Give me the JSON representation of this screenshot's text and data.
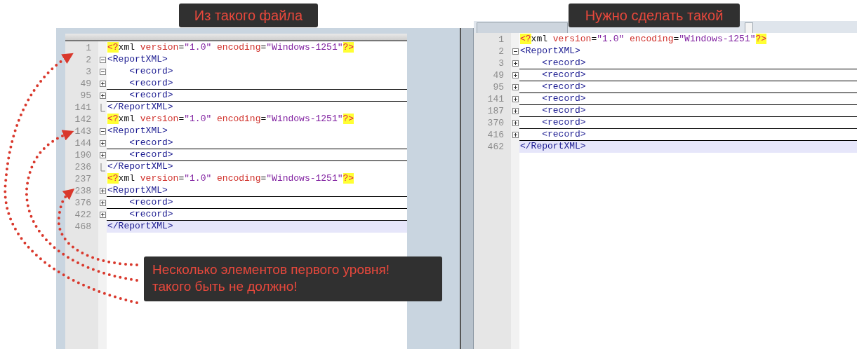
{
  "captions": [
    {
      "text": "Из такого файла"
    },
    {
      "text": "Нужно сделать такой"
    }
  ],
  "editors": [
    {
      "lines": [
        {
          "number": "1",
          "kind": "plain",
          "underline": false,
          "current": false,
          "tokens": [
            {
              "kind": "pi",
              "text": "<?"
            },
            {
              "kind": "name",
              "text": "xml"
            },
            {
              "kind": "attr",
              "text": " version"
            },
            {
              "kind": "eq",
              "text": "="
            },
            {
              "kind": "value",
              "text": "\"1.0\""
            },
            {
              "kind": "attr",
              "text": " encoding"
            },
            {
              "kind": "eq",
              "text": "="
            },
            {
              "kind": "value",
              "text": "\"Windows-1251\""
            },
            {
              "kind": "pi",
              "text": "?>"
            }
          ]
        },
        {
          "number": "2",
          "kind": "collapse",
          "underline": false,
          "current": false,
          "tokens": [
            {
              "kind": "tag",
              "text": "<ReportXML>"
            }
          ]
        },
        {
          "number": "3",
          "kind": "collapse",
          "underline": false,
          "current": false,
          "tokens": [
            {
              "kind": "tag",
              "text": "    <record>"
            }
          ]
        },
        {
          "number": "49",
          "kind": "expand",
          "underline": true,
          "current": false,
          "tokens": [
            {
              "kind": "tag",
              "text": "    <record>"
            }
          ]
        },
        {
          "number": "95",
          "kind": "expand",
          "underline": true,
          "current": false,
          "tokens": [
            {
              "kind": "tag",
              "text": "    <record>"
            }
          ]
        },
        {
          "number": "141",
          "kind": "block-end",
          "underline": false,
          "current": false,
          "tokens": [
            {
              "kind": "tag",
              "text": "</ReportXML>"
            }
          ]
        },
        {
          "number": "142",
          "kind": "plain",
          "underline": false,
          "current": false,
          "tokens": [
            {
              "kind": "pi",
              "text": "<?"
            },
            {
              "kind": "name",
              "text": "xml"
            },
            {
              "kind": "attr",
              "text": " version"
            },
            {
              "kind": "eq",
              "text": "="
            },
            {
              "kind": "value",
              "text": "\"1.0\""
            },
            {
              "kind": "attr",
              "text": " encoding"
            },
            {
              "kind": "eq",
              "text": "="
            },
            {
              "kind": "value",
              "text": "\"Windows-1251\""
            },
            {
              "kind": "pi",
              "text": "?>"
            }
          ]
        },
        {
          "number": "143",
          "kind": "collapse",
          "underline": false,
          "current": false,
          "tokens": [
            {
              "kind": "tag",
              "text": "<ReportXML>"
            }
          ]
        },
        {
          "number": "144",
          "kind": "expand",
          "underline": true,
          "current": false,
          "tokens": [
            {
              "kind": "tag",
              "text": "    <record>"
            }
          ]
        },
        {
          "number": "190",
          "kind": "expand",
          "underline": true,
          "current": false,
          "tokens": [
            {
              "kind": "tag",
              "text": "    <record>"
            }
          ]
        },
        {
          "number": "236",
          "kind": "block-end",
          "underline": false,
          "current": false,
          "tokens": [
            {
              "kind": "tag",
              "text": "</ReportXML>"
            }
          ]
        },
        {
          "number": "237",
          "kind": "plain",
          "underline": false,
          "current": false,
          "tokens": [
            {
              "kind": "pi",
              "text": "<?"
            },
            {
              "kind": "name",
              "text": "xml"
            },
            {
              "kind": "attr",
              "text": " version"
            },
            {
              "kind": "eq",
              "text": "="
            },
            {
              "kind": "value",
              "text": "\"1.0\""
            },
            {
              "kind": "attr",
              "text": " encoding"
            },
            {
              "kind": "eq",
              "text": "="
            },
            {
              "kind": "value",
              "text": "\"Windows-1251\""
            },
            {
              "kind": "pi",
              "text": "?>"
            }
          ]
        },
        {
          "number": "238",
          "kind": "expand",
          "underline": true,
          "current": false,
          "tokens": [
            {
              "kind": "tag",
              "text": "<ReportXML>"
            }
          ]
        },
        {
          "number": "376",
          "kind": "expand",
          "underline": true,
          "current": false,
          "tokens": [
            {
              "kind": "tag",
              "text": "    <record>"
            }
          ]
        },
        {
          "number": "422",
          "kind": "expand",
          "underline": true,
          "current": false,
          "tokens": [
            {
              "kind": "tag",
              "text": "    <record>"
            }
          ]
        },
        {
          "number": "468",
          "kind": "plain",
          "underline": false,
          "current": true,
          "tokens": [
            {
              "kind": "tag",
              "text": "</ReportXML>"
            }
          ]
        }
      ]
    },
    {
      "lines": [
        {
          "number": "1",
          "kind": "plain",
          "underline": false,
          "current": false,
          "tokens": [
            {
              "kind": "pi",
              "text": "<?"
            },
            {
              "kind": "name",
              "text": "xml"
            },
            {
              "kind": "attr",
              "text": " version"
            },
            {
              "kind": "eq",
              "text": "="
            },
            {
              "kind": "value",
              "text": "\"1.0\""
            },
            {
              "kind": "attr",
              "text": " encoding"
            },
            {
              "kind": "eq",
              "text": "="
            },
            {
              "kind": "value",
              "text": "\"Windows-1251\""
            },
            {
              "kind": "pi",
              "text": "?>"
            }
          ]
        },
        {
          "number": "2",
          "kind": "collapse",
          "underline": false,
          "current": false,
          "tokens": [
            {
              "kind": "tag",
              "text": "<ReportXML>"
            }
          ]
        },
        {
          "number": "3",
          "kind": "expand",
          "underline": true,
          "current": false,
          "tokens": [
            {
              "kind": "tag",
              "text": "    <record>"
            }
          ]
        },
        {
          "number": "49",
          "kind": "expand",
          "underline": true,
          "current": false,
          "tokens": [
            {
              "kind": "tag",
              "text": "    <record>"
            }
          ]
        },
        {
          "number": "95",
          "kind": "expand",
          "underline": true,
          "current": false,
          "tokens": [
            {
              "kind": "tag",
              "text": "    <record>"
            }
          ]
        },
        {
          "number": "141",
          "kind": "expand",
          "underline": true,
          "current": false,
          "tokens": [
            {
              "kind": "tag",
              "text": "    <record>"
            }
          ]
        },
        {
          "number": "187",
          "kind": "expand",
          "underline": true,
          "current": false,
          "tokens": [
            {
              "kind": "tag",
              "text": "    <record>"
            }
          ]
        },
        {
          "number": "370",
          "kind": "expand",
          "underline": true,
          "current": false,
          "tokens": [
            {
              "kind": "tag",
              "text": "    <record>"
            }
          ]
        },
        {
          "number": "416",
          "kind": "expand",
          "underline": true,
          "current": false,
          "tokens": [
            {
              "kind": "tag",
              "text": "    <record>"
            }
          ]
        },
        {
          "number": "462",
          "kind": "plain",
          "underline": false,
          "current": true,
          "tokens": [
            {
              "kind": "tag",
              "text": "</ReportXML>"
            }
          ]
        }
      ]
    }
  ],
  "note": {
    "text": "Несколько элементов первого уровня!\nтакого быть не должно!"
  }
}
